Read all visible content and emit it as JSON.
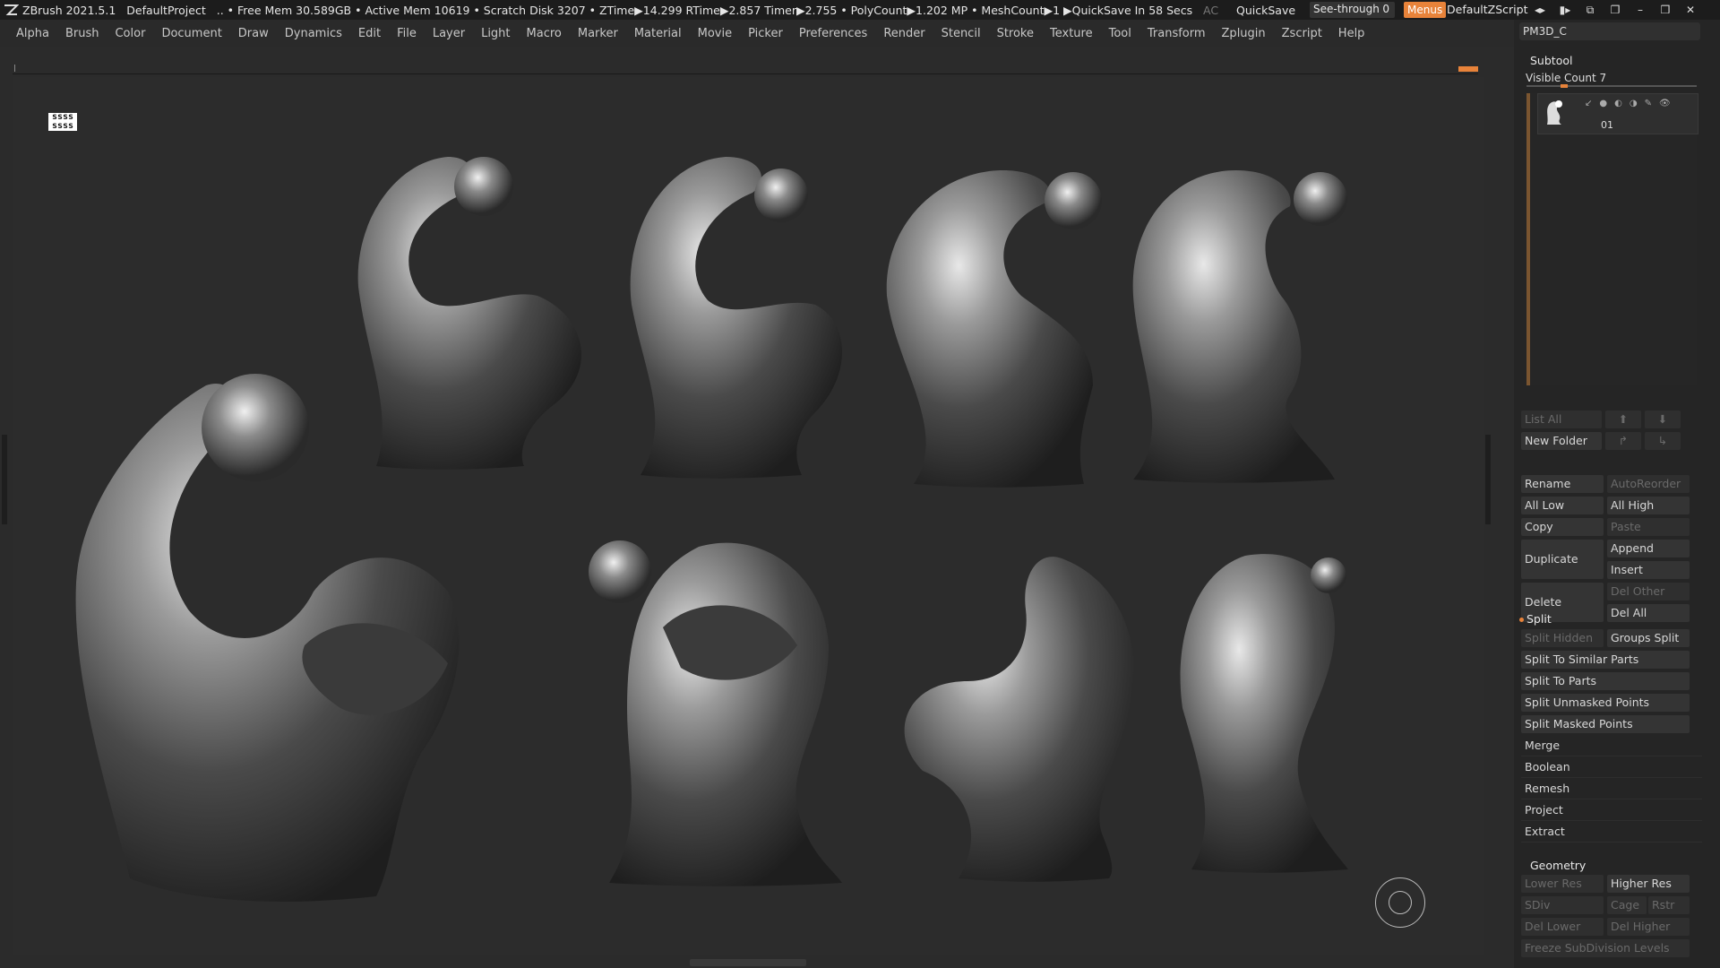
{
  "titlebar": {
    "app": "ZBrush 2021.5.1",
    "project": "DefaultProject",
    "stats": ".. • Free Mem 30.589GB • Active Mem 10619 • Scratch Disk 3207 • ZTime▶14.299 RTime▶2.857 Timer▶2.755 • PolyCount▶1.202 MP • MeshCount▶1 ▶QuickSave In 58 Secs",
    "ac": "AC",
    "quicksave": "QuickSave",
    "seethrough_label": "See-through",
    "seethrough_value": "0",
    "seethrough_level": 0.0,
    "menus": "Menus",
    "script": "DefaultZScript"
  },
  "menu": [
    "Alpha",
    "Brush",
    "Color",
    "Document",
    "Draw",
    "Dynamics",
    "Edit",
    "File",
    "Layer",
    "Light",
    "Macro",
    "Marker",
    "Material",
    "Movie",
    "Picker",
    "Preferences",
    "Render",
    "Stencil",
    "Stroke",
    "Texture",
    "Tool",
    "Transform",
    "Zplugin",
    "Zscript",
    "Help"
  ],
  "viewport": {
    "badge": "ssss ssss"
  },
  "panel": {
    "tool_name": "PM3D_C",
    "subtool_title": "Subtool",
    "visible_count": "Visible Count 7",
    "subtool_item": "01",
    "list_all": "List All",
    "new_folder": "New Folder",
    "rename": "Rename",
    "auto_reorder": "AutoReorder",
    "all_low": "All Low",
    "all_high": "All High",
    "copy": "Copy",
    "paste": "Paste",
    "duplicate": "Duplicate",
    "append": "Append",
    "insert": "Insert",
    "delete": "Delete",
    "del_other": "Del Other",
    "del_all": "Del All",
    "split": "Split",
    "split_hidden": "Split Hidden",
    "groups_split": "Groups Split",
    "split_similar": "Split To Similar Parts",
    "split_parts": "Split To Parts",
    "split_unmasked": "Split Unmasked Points",
    "split_masked": "Split Masked Points",
    "merge": "Merge",
    "boolean": "Boolean",
    "remesh": "Remesh",
    "project": "Project",
    "extract": "Extract",
    "geometry_title": "Geometry",
    "lower_res": "Lower Res",
    "higher_res": "Higher Res",
    "sdiv": "SDiv",
    "cage": "Cage",
    "rstr": "Rstr",
    "del_lower": "Del Lower",
    "del_higher": "Del Higher",
    "freeze_subdiv": "Freeze SubDivision Levels"
  },
  "colors": {
    "accent": "#e8833a",
    "panel": "#252525",
    "viewport": "#2c2c2c"
  }
}
